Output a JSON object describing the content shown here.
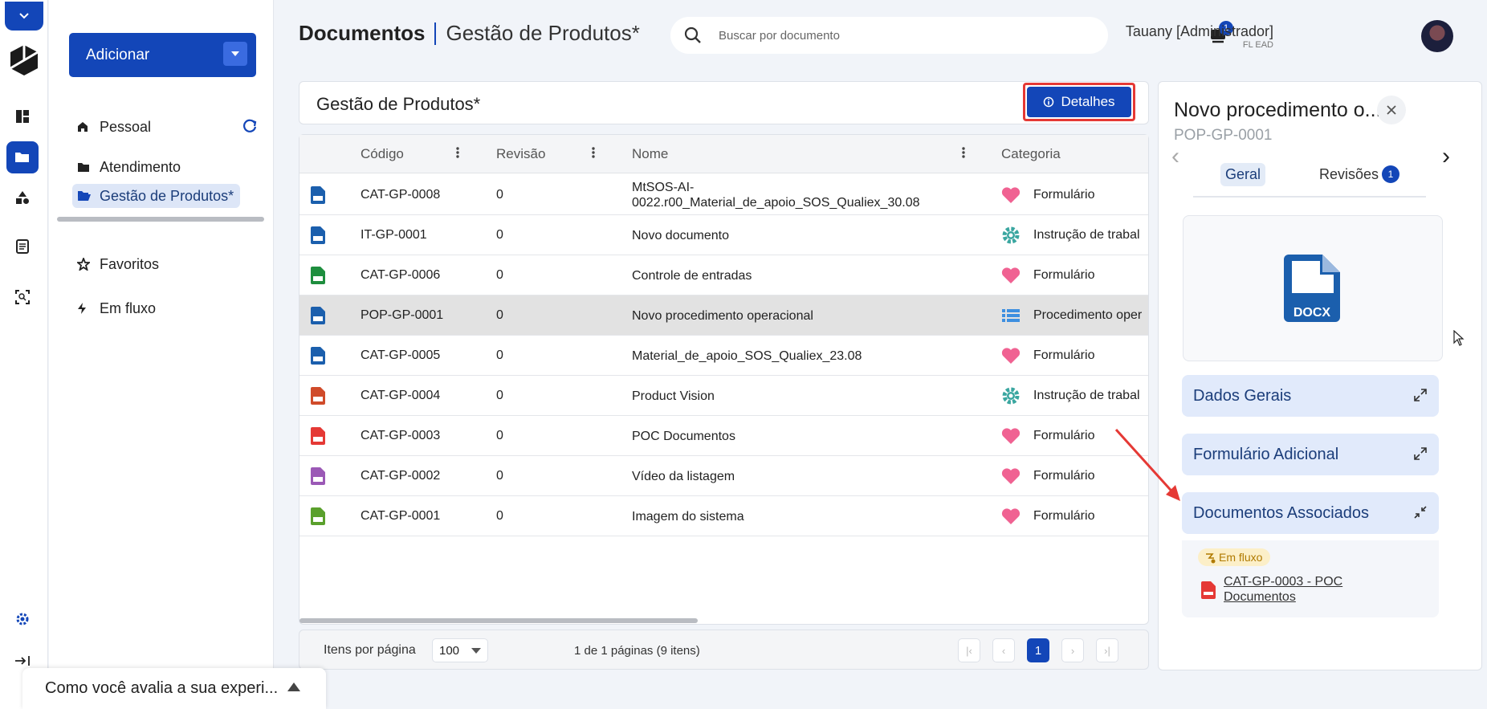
{
  "header": {
    "title": "Documentos",
    "subtitle": "Gestão de Produtos*",
    "search_placeholder": "Buscar por documento",
    "notif_count": "1",
    "user_name": "Tauany [Administrador]",
    "user_org": "FL EAD"
  },
  "nav": {
    "add_label": "Adicionar",
    "items": [
      {
        "label": "Pessoal",
        "icon": "home-icon"
      },
      {
        "label": "Atendimento",
        "icon": "folder-icon"
      },
      {
        "label": "Gestão de Produtos*",
        "icon": "folder-open-icon"
      },
      {
        "label": "Favoritos",
        "icon": "star-icon"
      },
      {
        "label": "Em fluxo",
        "icon": "bolt-icon"
      }
    ]
  },
  "table": {
    "title": "Gestão de Produtos*",
    "details_label": "Detalhes",
    "columns": [
      "Código",
      "Revisão",
      "Nome",
      "Categoria"
    ],
    "rows": [
      {
        "code": "CAT-GP-0008",
        "rev": "0",
        "name": "MtSOS-AI-0022.r00_Material_de_apoio_SOS_Qualiex_30.08",
        "cat": "Formulário",
        "type": "docx",
        "caticon": "heart"
      },
      {
        "code": "IT-GP-0001",
        "rev": "0",
        "name": "Novo documento",
        "cat": "Instrução de trabal",
        "type": "docx",
        "caticon": "gear"
      },
      {
        "code": "CAT-GP-0006",
        "rev": "0",
        "name": "Controle de entradas",
        "cat": "Formulário",
        "type": "xlsx",
        "caticon": "heart"
      },
      {
        "code": "POP-GP-0001",
        "rev": "0",
        "name": "Novo procedimento operacional",
        "cat": "Procedimento oper",
        "type": "docx",
        "caticon": "list"
      },
      {
        "code": "CAT-GP-0005",
        "rev": "0",
        "name": "Material_de_apoio_SOS_Qualiex_23.08",
        "cat": "Formulário",
        "type": "docx",
        "caticon": "heart"
      },
      {
        "code": "CAT-GP-0004",
        "rev": "0",
        "name": "Product Vision",
        "cat": "Instrução de trabal",
        "type": "pptx",
        "caticon": "gear"
      },
      {
        "code": "CAT-GP-0003",
        "rev": "0",
        "name": "POC Documentos",
        "cat": "Formulário",
        "type": "pdf",
        "caticon": "heart"
      },
      {
        "code": "CAT-GP-0002",
        "rev": "0",
        "name": "Vídeo da listagem",
        "cat": "Formulário",
        "type": "gif",
        "caticon": "heart"
      },
      {
        "code": "CAT-GP-0001",
        "rev": "0",
        "name": "Imagem do sistema",
        "cat": "Formulário",
        "type": "png",
        "caticon": "heart"
      }
    ],
    "items_per_page_label": "Itens por página",
    "items_per_page": "100",
    "page_info": "1 de 1 páginas (9 itens)",
    "current_page": "1"
  },
  "details": {
    "title": "Novo procedimento o...",
    "code": "POP-GP-0001",
    "tabs": [
      {
        "label": "Geral"
      },
      {
        "label": "Revisões",
        "badge": "1"
      }
    ],
    "file_label": "DOCX",
    "sections": [
      "Dados Gerais",
      "Formulário Adicional",
      "Documentos Associados"
    ],
    "assoc_status": "Em fluxo",
    "assoc_doc": "CAT-GP-0003 - POC Documentos"
  },
  "feedback": {
    "text": "Como você avalia a sua experi..."
  },
  "colors": {
    "primary": "#1346b8",
    "highlight": "#e53935"
  }
}
